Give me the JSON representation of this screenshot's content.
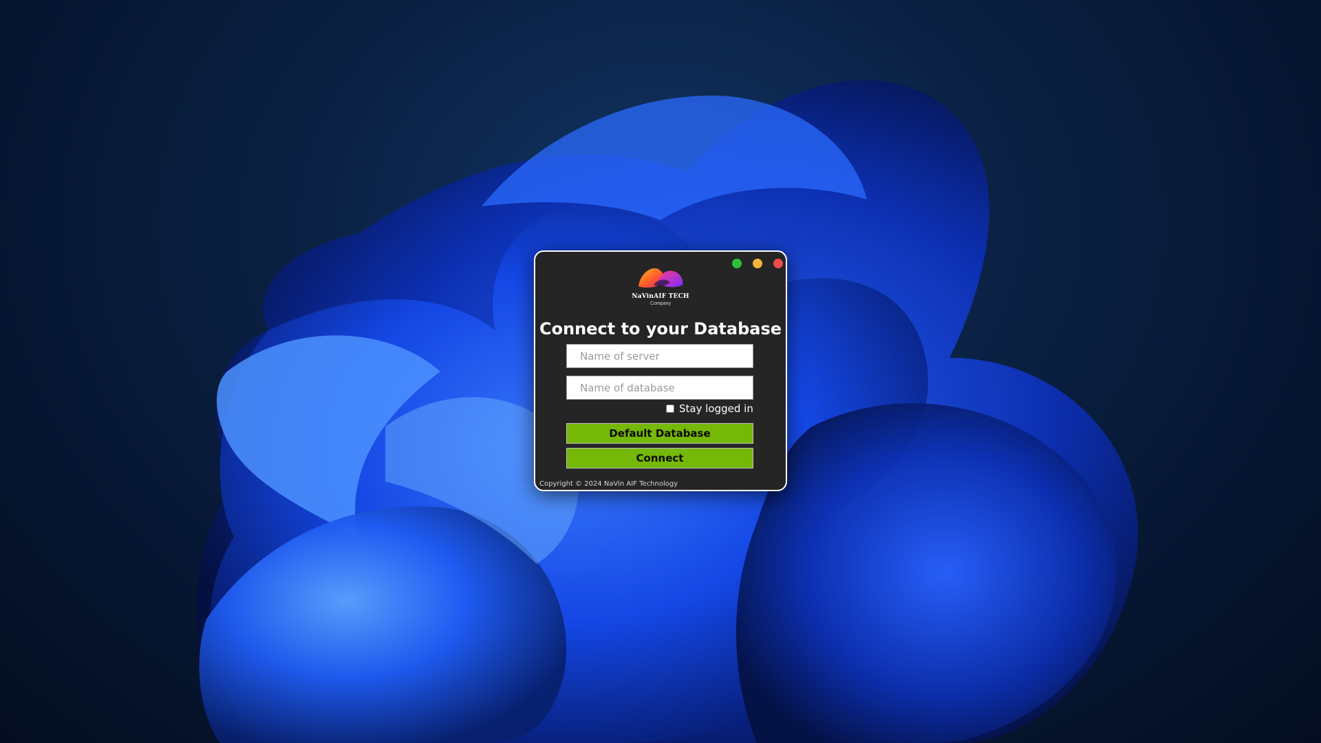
{
  "window": {
    "controls": {
      "maximize_color": "#2fbf3c",
      "minimize_color": "#f4b43a",
      "close_color": "#f04b4b"
    },
    "brand": {
      "logo_icon": "navinaif-logo-icon",
      "name": "NaVinAIF TECH",
      "subtitle": "Company"
    },
    "title": "Connect to your Database",
    "server_field": {
      "placeholder": "Name of server",
      "value": ""
    },
    "database_field": {
      "placeholder": "Name of database",
      "value": ""
    },
    "remember": {
      "label": "Stay logged in",
      "checked": false
    },
    "buttons": {
      "default_database": "Default Database",
      "connect": "Connect"
    },
    "footer": "Copyright © 2024 NaVin AIF Technology",
    "accent_color": "#75b807"
  }
}
